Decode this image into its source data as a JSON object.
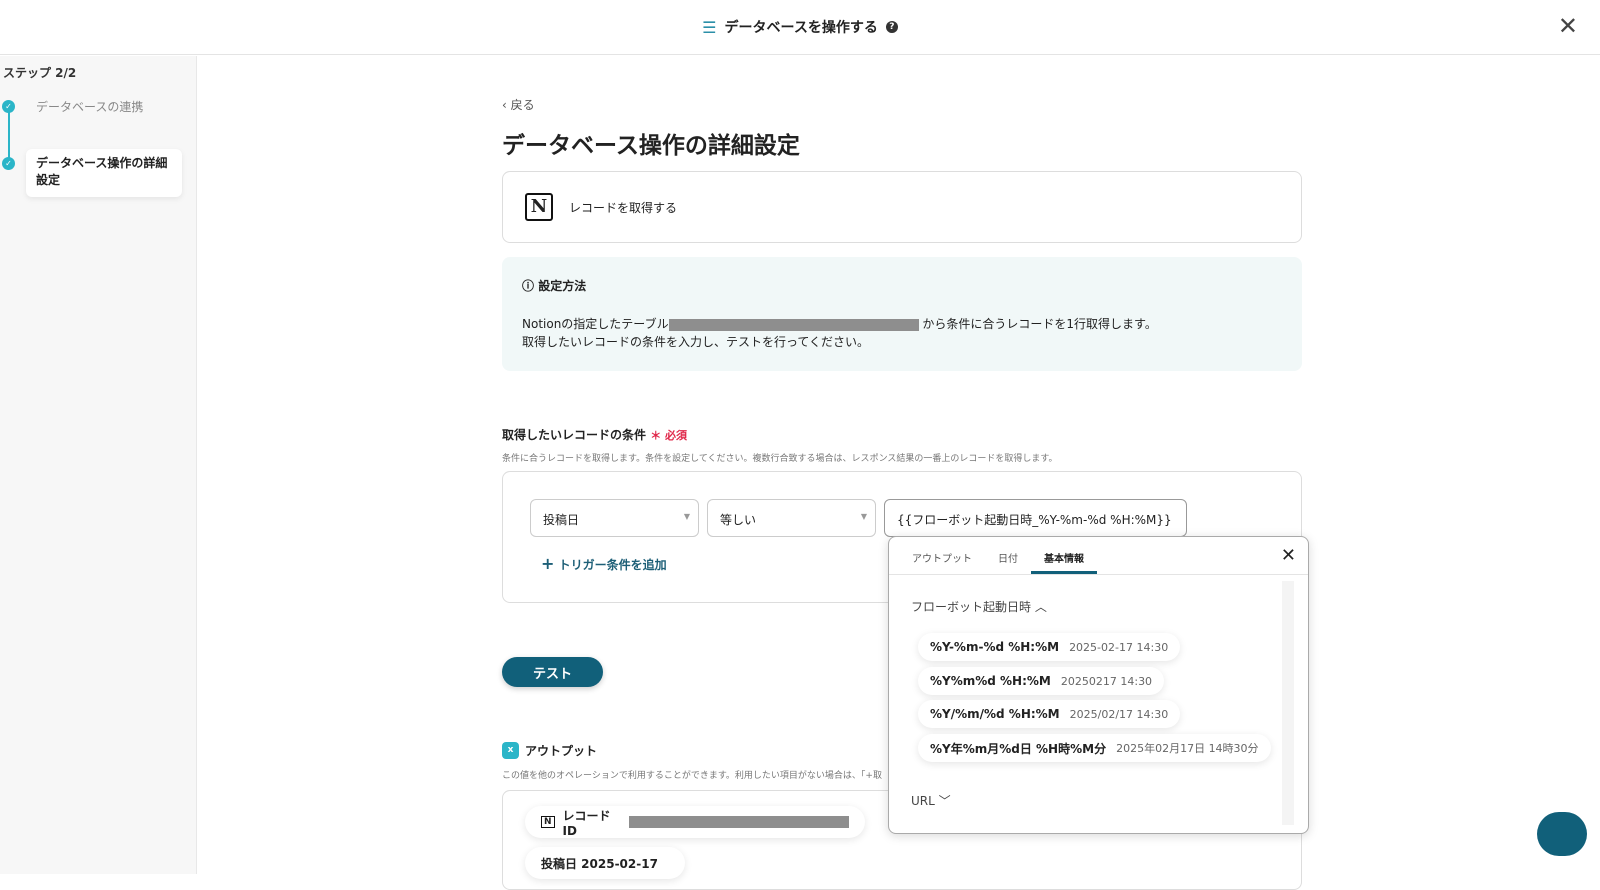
{
  "header": {
    "title": "データベースを操作する",
    "help": "?",
    "close": "✕"
  },
  "sidebar": {
    "step": "ステップ 2/2",
    "steps": [
      "データベースの連携",
      "データベース操作の詳細設定"
    ]
  },
  "main": {
    "back": "戻る",
    "title": "データベース操作の詳細設定",
    "action": "レコードを取得する",
    "info": {
      "title": "設定方法",
      "line1_pre": "Notionの指定したテーブル",
      "line1_post": " から条件に合うレコードを1行取得します。",
      "line2": "取得したいレコードの条件を入力し、テストを行ってください。"
    },
    "condition": {
      "title": "取得したいレコードの条件",
      "required": "＊ 必須",
      "desc": "条件に合うレコードを取得します。条件を設定してください。複数行合致する場合は、レスポンス結果の一番上のレコードを取得します。",
      "field": "投稿日",
      "operator": "等しい",
      "value": "{{フローボット起動日時_%Y-%m-%d %H:%M}}",
      "add": "トリガー条件を追加"
    },
    "test": "テスト",
    "output": {
      "title": "アウトプット",
      "desc": "この値を他のオペレーションで利用することができます。利用したい項目がない場合は、「+取",
      "items": [
        "レコードID",
        "投稿日 2025-02-17"
      ]
    }
  },
  "popup": {
    "tabs": [
      "アウトプット",
      "日付",
      "基本情報"
    ],
    "active_tab": 2,
    "section": "フローボット起動日時",
    "options": [
      {
        "fmt": "%Y-%m-%d %H:%M",
        "ex": "2025-02-17 14:30"
      },
      {
        "fmt": "%Y%m%d %H:%M",
        "ex": "20250217 14:30"
      },
      {
        "fmt": "%Y/%m/%d %H:%M",
        "ex": "2025/02/17 14:30"
      },
      {
        "fmt": "%Y年%m月%d日 %H時%M分",
        "ex": "2025年02月17日 14時30分"
      }
    ],
    "url": "URL"
  }
}
